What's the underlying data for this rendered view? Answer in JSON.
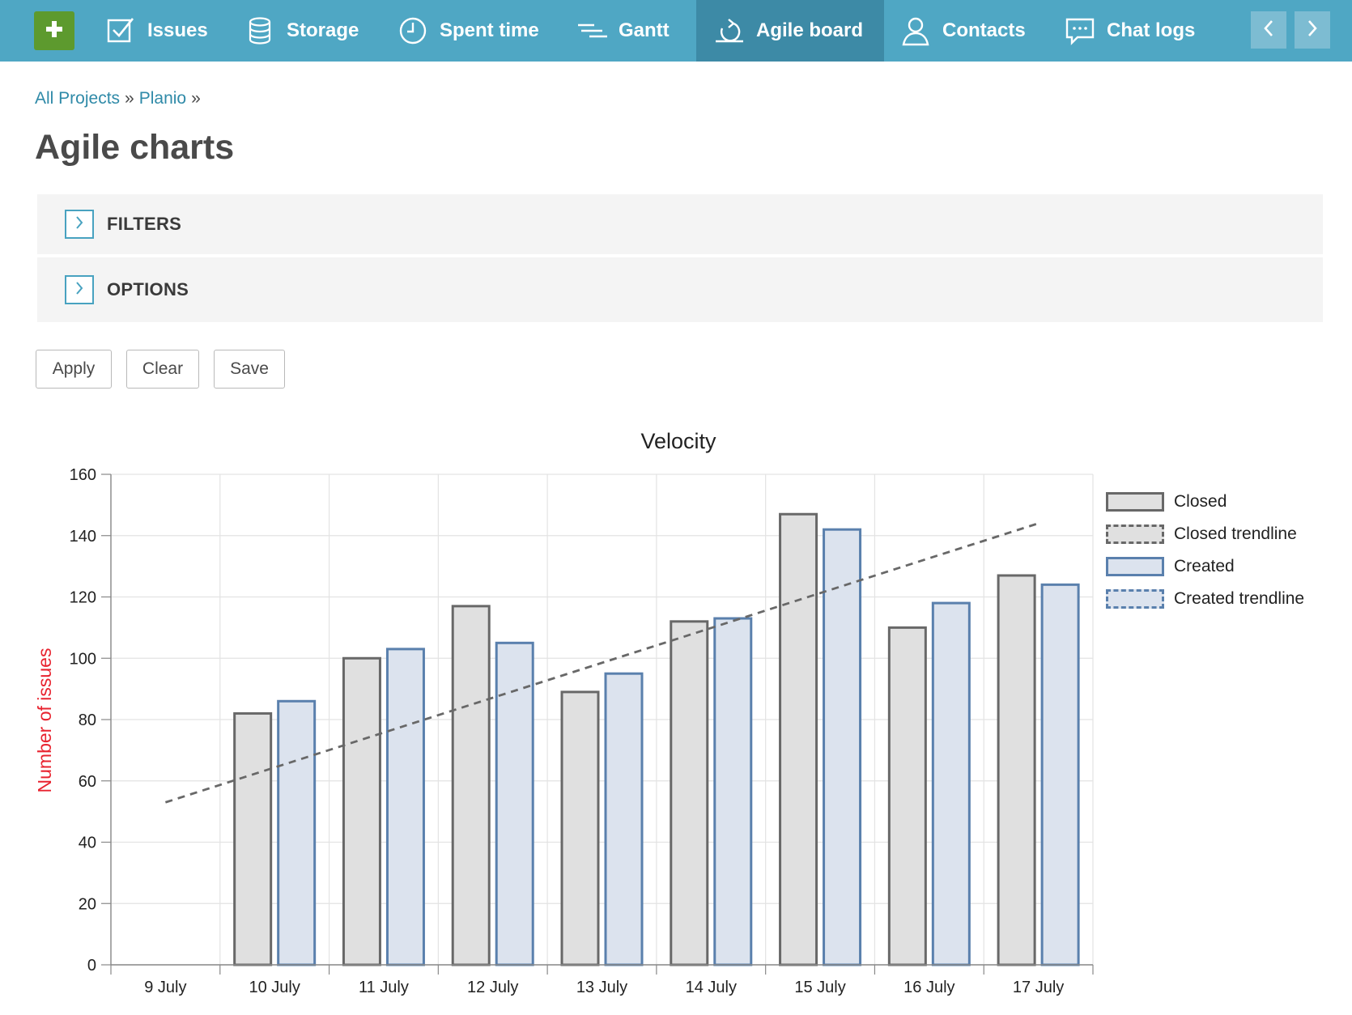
{
  "nav": {
    "items": [
      {
        "label": "Issues",
        "icon": "issues-icon"
      },
      {
        "label": "Storage",
        "icon": "storage-icon"
      },
      {
        "label": "Spent time",
        "icon": "clock-icon"
      },
      {
        "label": "Gantt",
        "icon": "gantt-icon"
      },
      {
        "label": "Agile board",
        "icon": "agile-icon",
        "active": true
      },
      {
        "label": "Contacts",
        "icon": "contacts-icon"
      },
      {
        "label": "Chat logs",
        "icon": "chat-icon"
      }
    ],
    "colors": {
      "bar": "#4fa7c4",
      "active": "#3d8aa6",
      "plus": "#5d9a2e"
    }
  },
  "breadcrumb": {
    "items": [
      "All Projects",
      "Planio"
    ],
    "separator": "»"
  },
  "page": {
    "title": "Agile charts"
  },
  "panels": {
    "filters": "FILTERS",
    "options": "OPTIONS"
  },
  "buttons": {
    "apply": "Apply",
    "clear": "Clear",
    "save": "Save"
  },
  "chart_data": {
    "type": "bar",
    "title": "Velocity",
    "ylabel": "Number of issues",
    "xlabel": "",
    "ylim": [
      0,
      160
    ],
    "yticks": [
      0,
      20,
      40,
      60,
      80,
      100,
      120,
      140,
      160
    ],
    "categories": [
      "9 July",
      "10 July",
      "11 July",
      "12 July",
      "13 July",
      "14 July",
      "15 July",
      "16 July",
      "17 July"
    ],
    "series": [
      {
        "name": "Closed",
        "values": [
          null,
          82,
          100,
          117,
          89,
          112,
          147,
          110,
          127
        ],
        "color": "#686868",
        "fill": "#e0e0e0"
      },
      {
        "name": "Created",
        "values": [
          null,
          86,
          103,
          105,
          95,
          113,
          142,
          118,
          124
        ],
        "color": "#5a80ad",
        "fill": "#dce3ee"
      }
    ],
    "trendlines": [
      {
        "name": "Closed trendline",
        "from": [
          "9 July",
          53
        ],
        "to": [
          "17 July",
          144
        ],
        "color": "#686868"
      }
    ],
    "legend": [
      {
        "name": "Closed",
        "style": "solid",
        "color": "#686868",
        "fill": "#e0e0e0"
      },
      {
        "name": "Closed trendline",
        "style": "dashed",
        "color": "#686868",
        "fill": "#e0e0e0"
      },
      {
        "name": "Created",
        "style": "solid",
        "color": "#5a80ad",
        "fill": "#dce3ee"
      },
      {
        "name": "Created trendline",
        "style": "dashed",
        "color": "#5a80ad",
        "fill": "#dce3ee"
      }
    ],
    "legend_position": "right",
    "grid": true,
    "ylabel_color": "#e8232f"
  }
}
